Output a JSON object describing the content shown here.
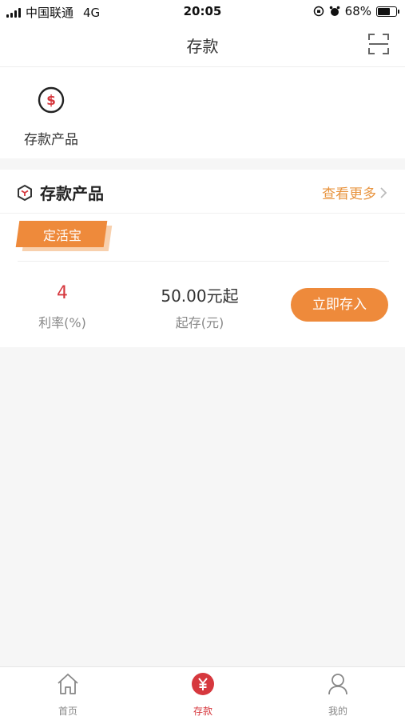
{
  "status_bar": {
    "carrier": "中国联通",
    "network": "4G",
    "time": "20:05",
    "battery": "68%",
    "battery_level": 0.68
  },
  "nav": {
    "title": "存款",
    "scan_icon": "scan-icon"
  },
  "quick_menu": {
    "items": [
      {
        "label": "存款产品",
        "icon": "dollar-circle-icon"
      }
    ]
  },
  "products": {
    "header_title": "存款产品",
    "header_icon": "cube-icon",
    "more_label": "查看更多",
    "item": {
      "tag": "定活宝",
      "rate_value": "4",
      "rate_label": "利率(%)",
      "min_value": "50.00元起",
      "min_label": "起存(元)",
      "button_label": "立即存入"
    }
  },
  "tab_bar": {
    "tabs": [
      {
        "label": "首页",
        "icon": "home-icon",
        "active": false
      },
      {
        "label": "存款",
        "icon": "yuan-circle-icon",
        "active": true
      },
      {
        "label": "我的",
        "icon": "user-icon",
        "active": false
      }
    ]
  },
  "colors": {
    "accent_orange": "#ee8a3b",
    "accent_red": "#d6383e",
    "background": "#f6f6f6"
  }
}
